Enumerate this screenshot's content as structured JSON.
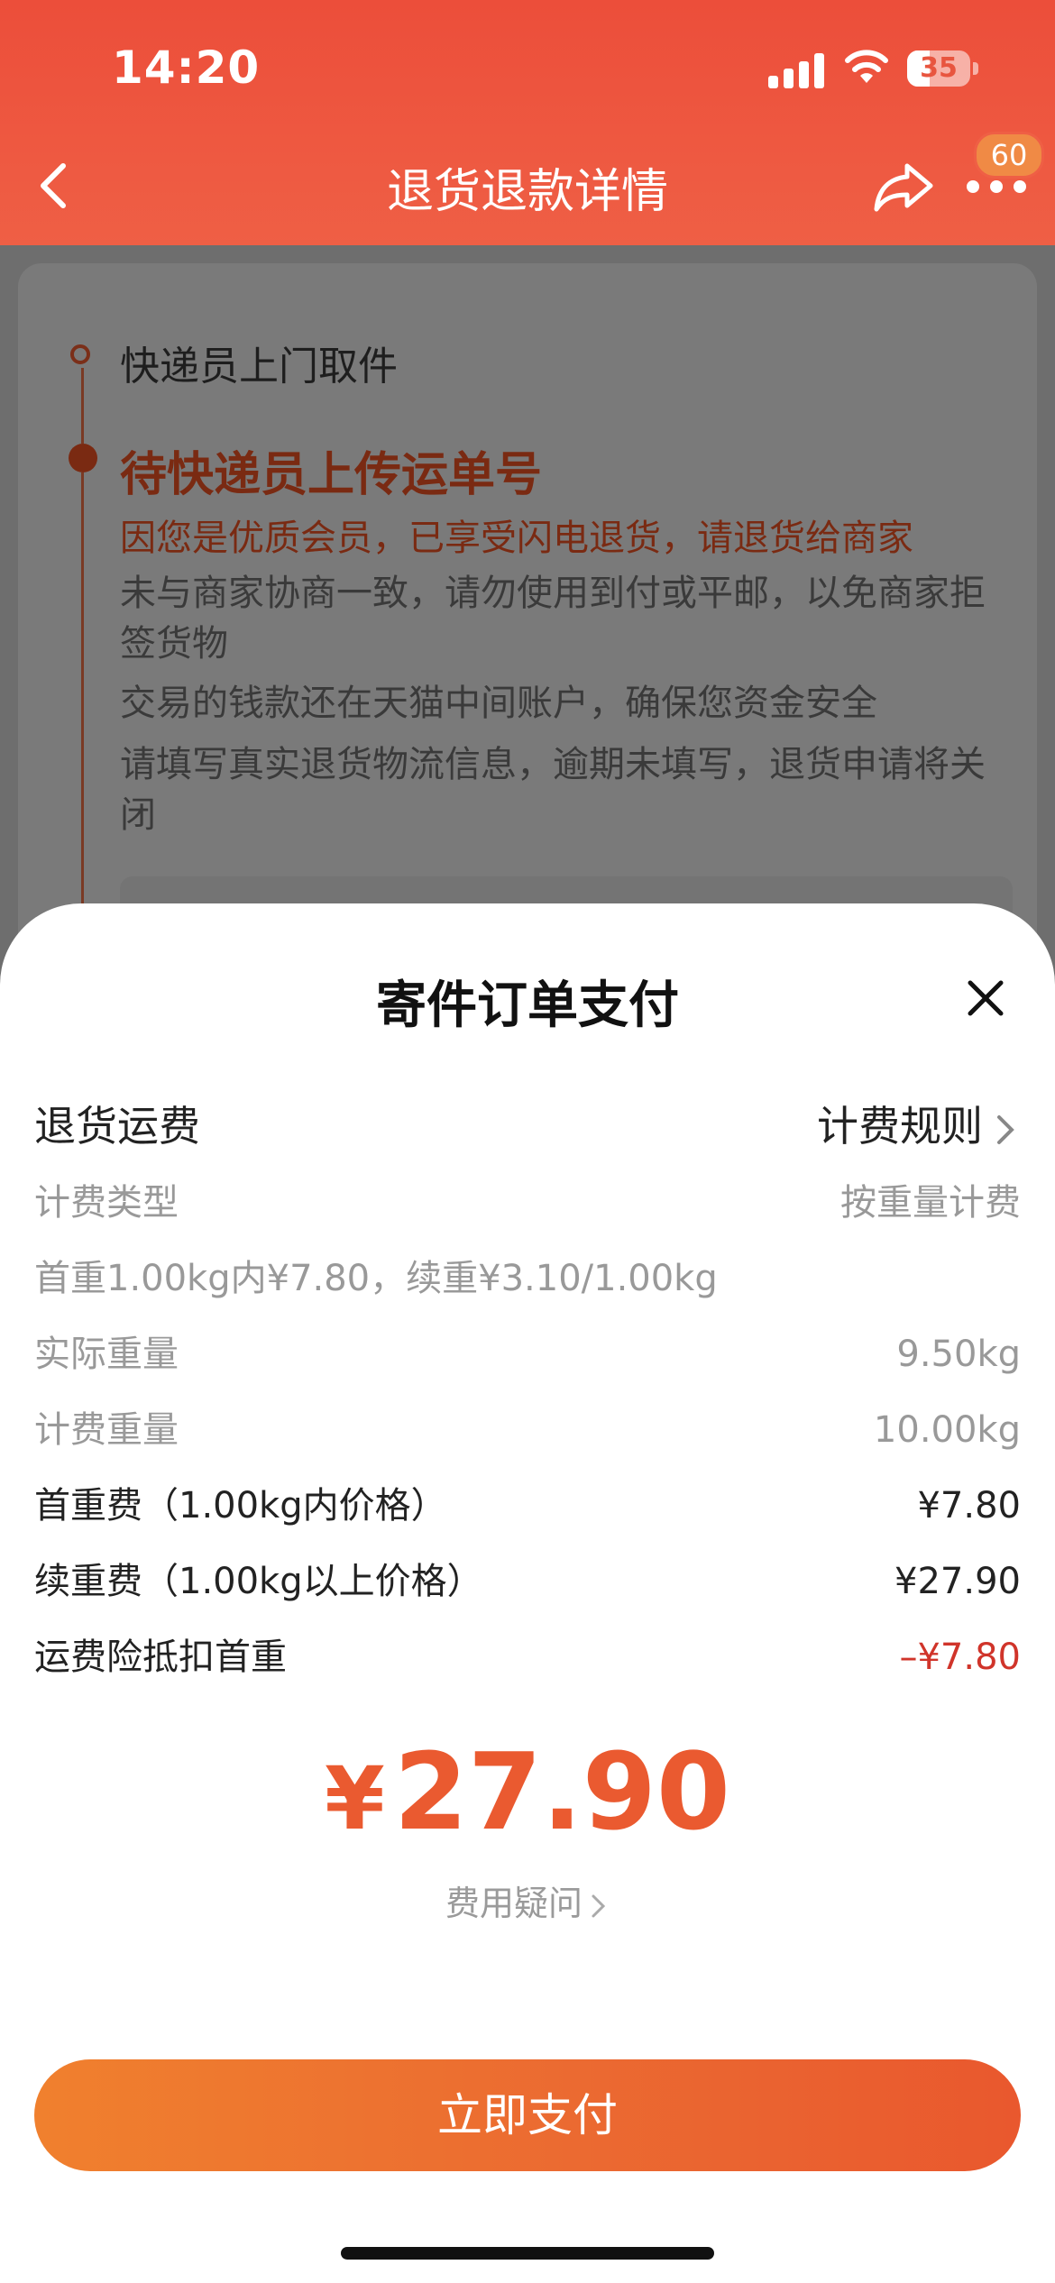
{
  "status_bar": {
    "time": "14:20",
    "battery": "35",
    "battery_level": 0.35
  },
  "nav": {
    "title": "退货退款详情",
    "badge": "60"
  },
  "background": {
    "steps": [
      "快递员上门取件",
      "待快递员上传运单号"
    ],
    "highlight": "因您是优质会员，已享受闪电退货，请退货给商家",
    "notes": [
      "未与商家协商一致，请勿使用到付或平邮，以免商家拒签货物",
      "交易的钱款还在天猫中间账户，确保您资金安全",
      "请填写真实退货物流信息，逾期未填写，退货申请将关闭"
    ]
  },
  "sheet": {
    "title": "寄件订单支付",
    "fee_label": "退货运费",
    "rules_link": "计费规则",
    "rows": [
      {
        "label": "计费类型",
        "value": "按重量计费"
      },
      {
        "label": "首重1.00kg内¥7.80，续重¥3.10/1.00kg",
        "value": ""
      },
      {
        "label": "实际重量",
        "value": "9.50kg"
      },
      {
        "label": "计费重量",
        "value": "10.00kg"
      },
      {
        "label": "首重费（1.00kg内价格）",
        "value": "¥7.80"
      },
      {
        "label": "续重费（1.00kg以上价格）",
        "value": "¥27.90"
      },
      {
        "label": "运费险抵扣首重",
        "value": "–¥7.80"
      }
    ],
    "total_currency": "¥",
    "total_amount": "27.90",
    "question": "费用疑问",
    "pay_button": "立即支付"
  },
  "colors": {
    "brand": "#ec4e3a",
    "price": "#ea5a30",
    "discount": "#d0342a"
  },
  "icons": [
    "back-icon",
    "share-icon",
    "more-icon",
    "close-icon",
    "chevron-right-icon"
  ]
}
